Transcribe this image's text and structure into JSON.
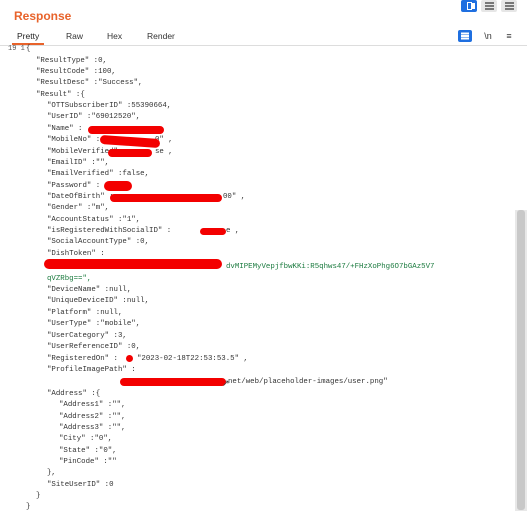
{
  "header": {
    "title": "Response"
  },
  "tabs": [
    "Pretty",
    "Raw",
    "Hex",
    "Render"
  ],
  "toolbar": {
    "wrap_label": "\\n",
    "menu_label": "≡"
  },
  "gutter": {
    "line_no": "19 1"
  },
  "json_lines": [
    "{",
    "\"ResultType\" :0,",
    "\"ResultCode\" :100,",
    "\"ResultDesc\" :\"Success\",",
    "\"Result\" :{",
    "\"OTTSubscriberID\" :55390664,",
    "\"UserID\" :\"69012520\",",
    "\"Name\" :",
    "\"MobileNo\" :",
    "\"MobileVerified\" :",
    "\"EmailID\" :\"\",",
    "\"EmailVerified\" :false,",
    "\"Password\" :",
    "\"DateOfBirth\" :",
    "\"Gender\" :\"m\",",
    "\"AccountStatus\" :\"1\",",
    "\"isRegisteredWithSocialID\" :",
    "\"SocialAccountType\" :0,",
    "\"DishToken\" :",
    "qVZRbg==\",",
    "\"DeviceName\" :null,",
    "\"UniqueDeviceID\" :null,",
    "\"Platform\" :null,",
    "\"UserType\" :\"mobile\",",
    "\"UserCategory\" :3,",
    "\"UserReferenceID\" :0,",
    "\"RegisteredOn\" :",
    "\"ProfileImagePath\" :",
    "\"Address\" :{",
    "\"Address1\" :\"\",",
    "\"Address2\" :\"\",",
    "\"Address3\" :\"\",",
    "\"City\" :\"0\",",
    "\"State\" :\"0\",",
    "\"PinCode\" :\"\"",
    "},",
    "\"SiteUserID\" :0",
    "}",
    "}"
  ],
  "values": {
    "mobile_tail": "0\" ,",
    "mobile_verified_tail": "se ,",
    "dob_tail": "00\" ,",
    "social_tail": "e ,",
    "dishtoken_tail": "dvMIPEMyVepjfbwKKi:R5qhws47/+FHzXoPhg6O7bGAz5V7",
    "registered_on": "\"2023-02-18T22:53:53.5\" ,",
    "profile_path_tail": "net/web/placeholder-images/user.png\""
  }
}
